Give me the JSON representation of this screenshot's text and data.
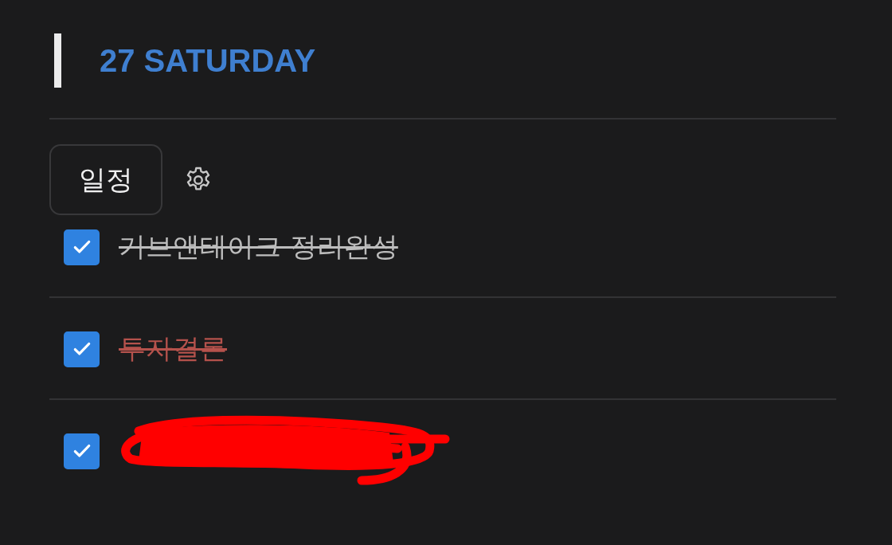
{
  "header": {
    "title": "27 SATURDAY"
  },
  "view_button": {
    "label": "일정"
  },
  "tasks": [
    {
      "kind": "task",
      "text": "기브앤테이크 정리완성",
      "checked": true,
      "color": "#bdbdbd"
    },
    {
      "kind": "task",
      "text": "투자결론",
      "checked": true,
      "color": "#b5524c"
    },
    {
      "kind": "redacted",
      "checked": true
    }
  ]
}
